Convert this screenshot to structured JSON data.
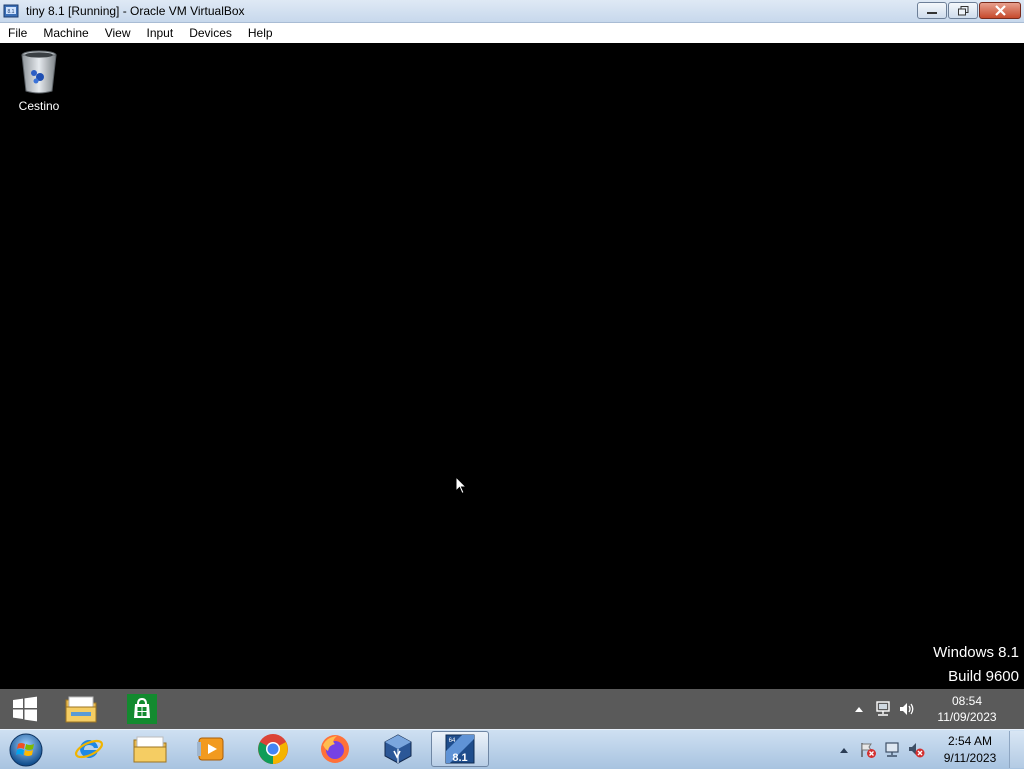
{
  "window": {
    "title": "tiny 8.1 [Running] - Oracle VM VirtualBox",
    "buttons": [
      "minimize",
      "restore",
      "close"
    ]
  },
  "menubar": {
    "items": [
      "File",
      "Machine",
      "View",
      "Input",
      "Devices",
      "Help"
    ]
  },
  "desktop": {
    "icons": [
      {
        "label": "Cestino",
        "icon": "recycle-bin-icon"
      }
    ],
    "watermark": {
      "line1": "Windows 8.1",
      "line2": "Build 9600"
    },
    "background": "#000000"
  },
  "guest_taskbar": {
    "pinned": [
      "start-icon",
      "file-explorer-icon",
      "store-icon"
    ],
    "tray_icons": [
      "show-hidden-icons",
      "network-icon",
      "volume-icon"
    ],
    "clock": {
      "time": "08:54",
      "date": "11/09/2023"
    },
    "color": "#5a5a5a"
  },
  "host_taskbar": {
    "pinned": [
      "internet-explorer-icon",
      "windows-explorer-icon",
      "media-player-icon",
      "chrome-icon",
      "firefox-icon",
      "virtualbox-icon",
      "tiny-81-vm-icon"
    ],
    "active": "tiny-81-vm-icon",
    "tray_icons": [
      "show-hidden-icons",
      "action-center-icon",
      "network-icon",
      "volume-muted-icon"
    ],
    "clock": {
      "time": "2:54 AM",
      "date": "9/11/2023"
    }
  }
}
